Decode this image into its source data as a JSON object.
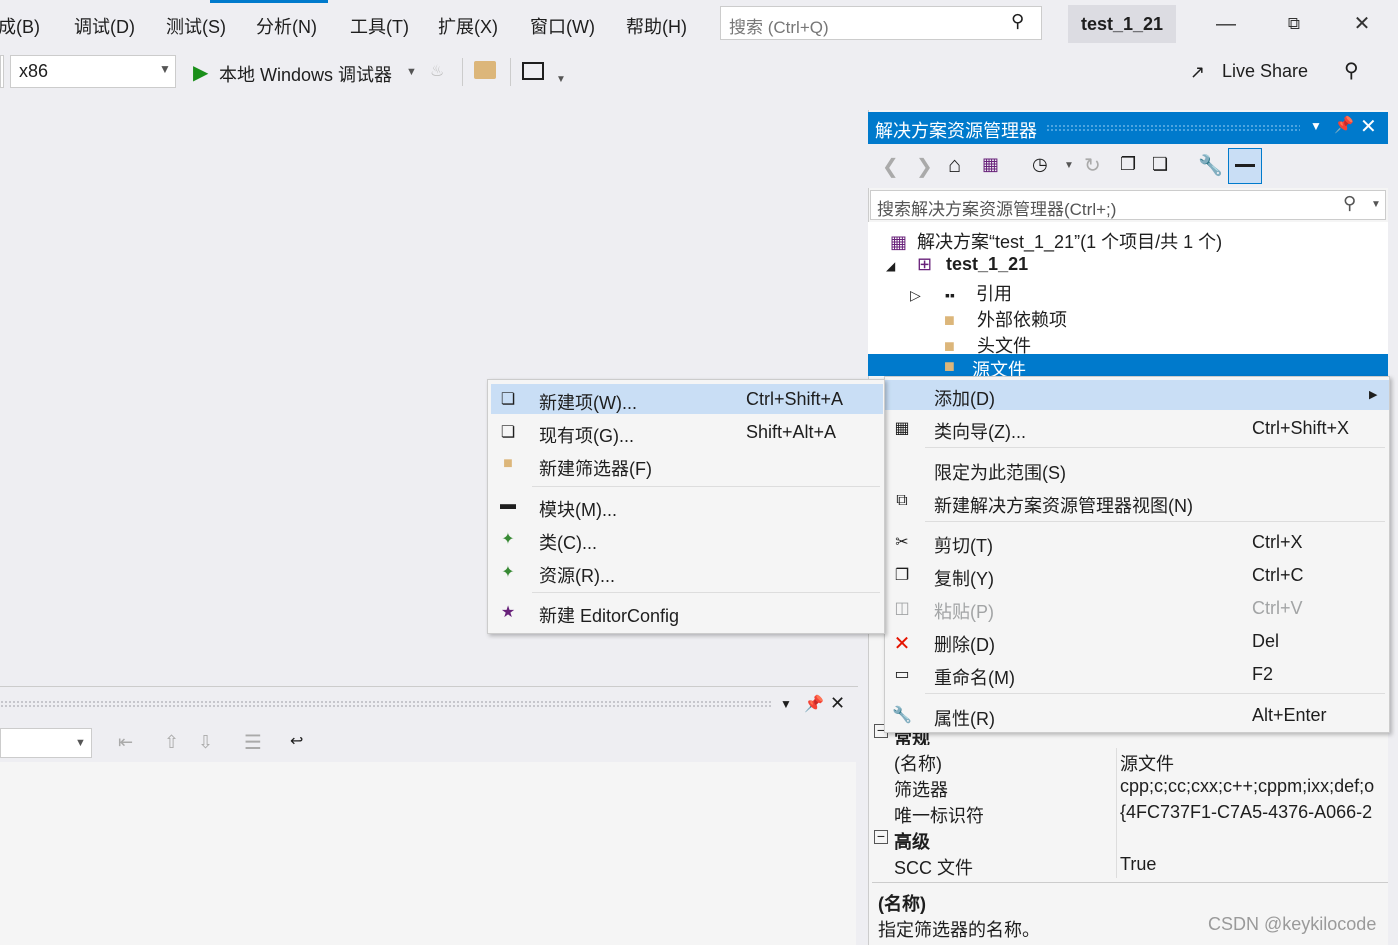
{
  "menubar": {
    "items": [
      "成(B)",
      "调试(D)",
      "测试(S)",
      "分析(N)",
      "工具(T)",
      "扩展(X)",
      "窗口(W)",
      "帮助(H)"
    ],
    "search_placeholder": "搜索 (Ctrl+Q)",
    "project_name": "test_1_21"
  },
  "toolbar": {
    "platform": "x86",
    "debugger_label": "本地 Windows 调试器",
    "live_share": "Live Share"
  },
  "solution_explorer": {
    "title": "解决方案资源管理器",
    "search_placeholder": "搜索解决方案资源管理器(Ctrl+;)",
    "tree": {
      "solution": "解决方案“test_1_21”(1 个项目/共 1 个)",
      "project": "test_1_21",
      "references": "引用",
      "external_deps": "外部依赖项",
      "header_files": "头文件",
      "source_files": "源文件"
    }
  },
  "context_menu": {
    "items": [
      {
        "label": "添加(D)",
        "shortcut": ""
      },
      {
        "label": "类向导(Z)...",
        "shortcut": "Ctrl+Shift+X"
      },
      {
        "label": "限定为此范围(S)",
        "shortcut": ""
      },
      {
        "label": "新建解决方案资源管理器视图(N)",
        "shortcut": ""
      },
      {
        "label": "剪切(T)",
        "shortcut": "Ctrl+X"
      },
      {
        "label": "复制(Y)",
        "shortcut": "Ctrl+C"
      },
      {
        "label": "粘贴(P)",
        "shortcut": "Ctrl+V"
      },
      {
        "label": "删除(D)",
        "shortcut": "Del"
      },
      {
        "label": "重命名(M)",
        "shortcut": "F2"
      },
      {
        "label": "属性(R)",
        "shortcut": "Alt+Enter"
      }
    ]
  },
  "add_submenu": {
    "items": [
      {
        "label": "新建项(W)...",
        "shortcut": "Ctrl+Shift+A"
      },
      {
        "label": "现有项(G)...",
        "shortcut": "Shift+Alt+A"
      },
      {
        "label": "新建筛选器(F)",
        "shortcut": ""
      },
      {
        "label": "模块(M)...",
        "shortcut": ""
      },
      {
        "label": "类(C)...",
        "shortcut": ""
      },
      {
        "label": "资源(R)...",
        "shortcut": ""
      },
      {
        "label": "新建 EditorConfig",
        "shortcut": ""
      }
    ]
  },
  "properties": {
    "section_general": "常规",
    "rows": [
      {
        "name": "(名称)",
        "value": "源文件"
      },
      {
        "name": "筛选器",
        "value": "cpp;c;cc;cxx;c++;cppm;ixx;def;o"
      },
      {
        "name": "唯一标识符",
        "value": "{4FC737F1-C7A5-4376-A066-2"
      }
    ],
    "section_advanced": "高级",
    "advanced_rows": [
      {
        "name": "SCC 文件",
        "value": "True"
      }
    ],
    "desc_title": "(名称)",
    "desc_text": "指定筛选器的名称。"
  },
  "watermark": "CSDN @keykilocode",
  "colors": {
    "accent": "#007acc",
    "menu_highlight": "#c9def5",
    "delete_red": "#e51400"
  }
}
